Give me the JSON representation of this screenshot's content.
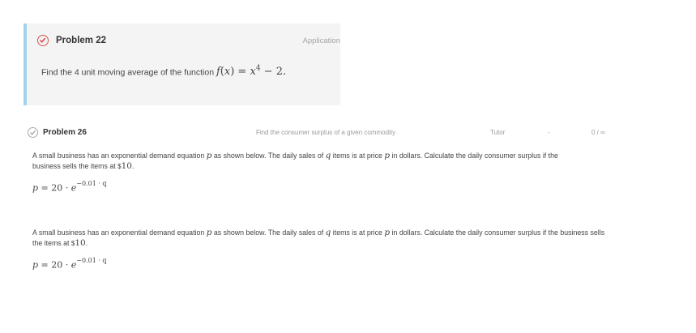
{
  "problem22": {
    "title": "Problem 22",
    "category": "Application",
    "text_prefix": "Find the 4 unit moving average of the function",
    "func_f": "f",
    "func_open": "(",
    "func_x": "x",
    "func_close": ")",
    "func_eq": " = ",
    "func_x2": "x",
    "func_exp": "4",
    "func_tail": " − 2.",
    "status_icon": "check-circle-icon",
    "accent_color": "#d9534f"
  },
  "problem26": {
    "title": "Problem 26",
    "description": "Find the consumer surplus of a given commodity",
    "mode": "Tutor",
    "dash": "-",
    "score": "0 / ∞",
    "status_icon": "check-circle-icon"
  },
  "para1": {
    "t1": "A small business has an exponential demand equation ",
    "v_p": "p",
    "t2": " as shown below. The daily sales of ",
    "v_q": "q",
    "t3": " items is at price ",
    "v_p2": "p",
    "t4": " in dollars. Calculate the daily consumer surplus if the",
    "t5": "business sells the items at ",
    "price_sym": "$",
    "price": "10",
    "t6": "."
  },
  "eq1": {
    "lhs": "p",
    "mid": " = 20 · ",
    "base": "e",
    "exp": "−0.01 · q"
  },
  "para2": {
    "t1": "A small business has an exponential demand equation ",
    "v_p": "p",
    "t2": " as shown below. The daily sales of ",
    "v_q": "q",
    "t3": " items is at price ",
    "v_p2": "p",
    "t4": " in dollars. Calculate the daily consumer surplus if the business sells",
    "t5": "the items at ",
    "price_sym": "$",
    "price": "10",
    "t6": "."
  },
  "eq2": {
    "lhs": "p",
    "mid": " = 20 · ",
    "base": "e",
    "exp": "−0.01 · q"
  }
}
